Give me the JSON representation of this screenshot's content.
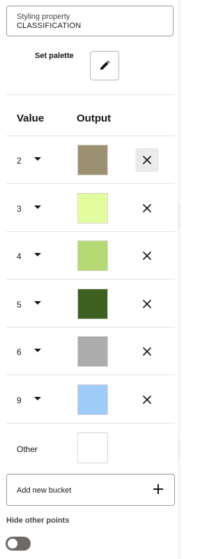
{
  "styling": {
    "label": "Styling property",
    "value": "CLASSIFICATION"
  },
  "palette": {
    "label": "Set palette",
    "icon": "pencil-icon"
  },
  "columns": {
    "value": "Value",
    "output": "Output"
  },
  "buckets": [
    {
      "value": "2",
      "color": "#9b9170"
    },
    {
      "value": "3",
      "color": "#e2fd9e"
    },
    {
      "value": "4",
      "color": "#b6da73"
    },
    {
      "value": "5",
      "color": "#3d6020"
    },
    {
      "value": "6",
      "color": "#acacac"
    },
    {
      "value": "9",
      "color": "#9ecbf8"
    }
  ],
  "other": {
    "label": "Other",
    "color": "#ffffff"
  },
  "add_bucket": {
    "label": "Add new bucket",
    "icon": "plus-icon"
  },
  "hide_points": {
    "label": "Hide other points",
    "enabled": false
  }
}
